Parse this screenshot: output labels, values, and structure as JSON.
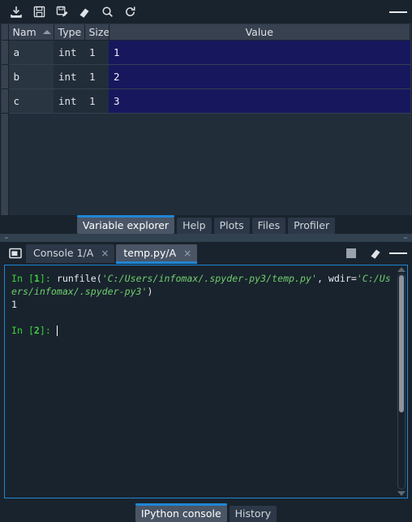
{
  "toolbar": {
    "icons": [
      {
        "name": "import-data-icon",
        "title": "Import data"
      },
      {
        "name": "save-data-icon",
        "title": "Save data"
      },
      {
        "name": "save-data-as-icon",
        "title": "Save data as"
      },
      {
        "name": "remove-all-variables-icon",
        "title": "Remove all variables"
      },
      {
        "name": "search-icon",
        "title": "Search"
      },
      {
        "name": "refresh-icon",
        "title": "Refresh"
      }
    ],
    "options_menu": "options-menu-icon"
  },
  "variable_explorer": {
    "columns": [
      "Nam",
      "Type",
      "Size",
      "Value"
    ],
    "sort_column": "Nam",
    "sort_direction": "ascending",
    "rows": [
      {
        "name": "a",
        "type": "int",
        "size": "1",
        "value": "1"
      },
      {
        "name": "b",
        "type": "int",
        "size": "1",
        "value": "2"
      },
      {
        "name": "c",
        "type": "int",
        "size": "1",
        "value": "3"
      }
    ]
  },
  "pane_tabs": {
    "items": [
      {
        "label": "Variable explorer",
        "active": true
      },
      {
        "label": "Help",
        "active": false
      },
      {
        "label": "Plots",
        "active": false
      },
      {
        "label": "Files",
        "active": false
      },
      {
        "label": "Profiler",
        "active": false
      }
    ]
  },
  "console": {
    "browse_icon": "browse-tabs-icon",
    "tabs": [
      {
        "label": "Console 1/A",
        "active": false,
        "close": "×"
      },
      {
        "label": "temp.py/A",
        "active": true,
        "close": "×"
      }
    ],
    "actions": [
      {
        "name": "stop-button",
        "title": "Interrupt kernel"
      },
      {
        "name": "remove-all-variables-icon",
        "title": "Remove all variables"
      },
      {
        "name": "options-menu-icon",
        "title": "Options"
      }
    ],
    "lines": [
      {
        "segments": [
          {
            "kind": "prompt",
            "text": "In ["
          },
          {
            "kind": "prompt-num",
            "text": "1"
          },
          {
            "kind": "prompt",
            "text": "]: "
          },
          {
            "kind": "code",
            "text": "runfile("
          },
          {
            "kind": "string",
            "text": "'C:/Users/infomax/.spyder-py3/temp.py'"
          },
          {
            "kind": "code",
            "text": ", wdir="
          },
          {
            "kind": "string",
            "text": "'C:/Users/infomax/.spyder-py3'"
          },
          {
            "kind": "code",
            "text": ")"
          }
        ]
      },
      {
        "segments": [
          {
            "kind": "output",
            "text": "1"
          }
        ]
      },
      {
        "segments": [
          {
            "kind": "blank",
            "text": ""
          }
        ]
      },
      {
        "segments": [
          {
            "kind": "prompt",
            "text": "In ["
          },
          {
            "kind": "prompt-num",
            "text": "2"
          },
          {
            "kind": "prompt",
            "text": "]: "
          },
          {
            "kind": "cursor",
            "text": ""
          }
        ]
      }
    ],
    "scroll": {
      "thumb_percent": "64"
    }
  },
  "bottom_tabs": {
    "items": [
      {
        "label": "IPython console",
        "active": true
      },
      {
        "label": "History",
        "active": false
      }
    ]
  },
  "colors": {
    "background": "#19232d",
    "panel": "#222d3a",
    "header": "#37414f",
    "accent": "#1f86d4",
    "selection": "#17175e",
    "prompt_green": "#3ad13a",
    "string_green": "#6fcf6f",
    "text": "#e7ebef"
  }
}
